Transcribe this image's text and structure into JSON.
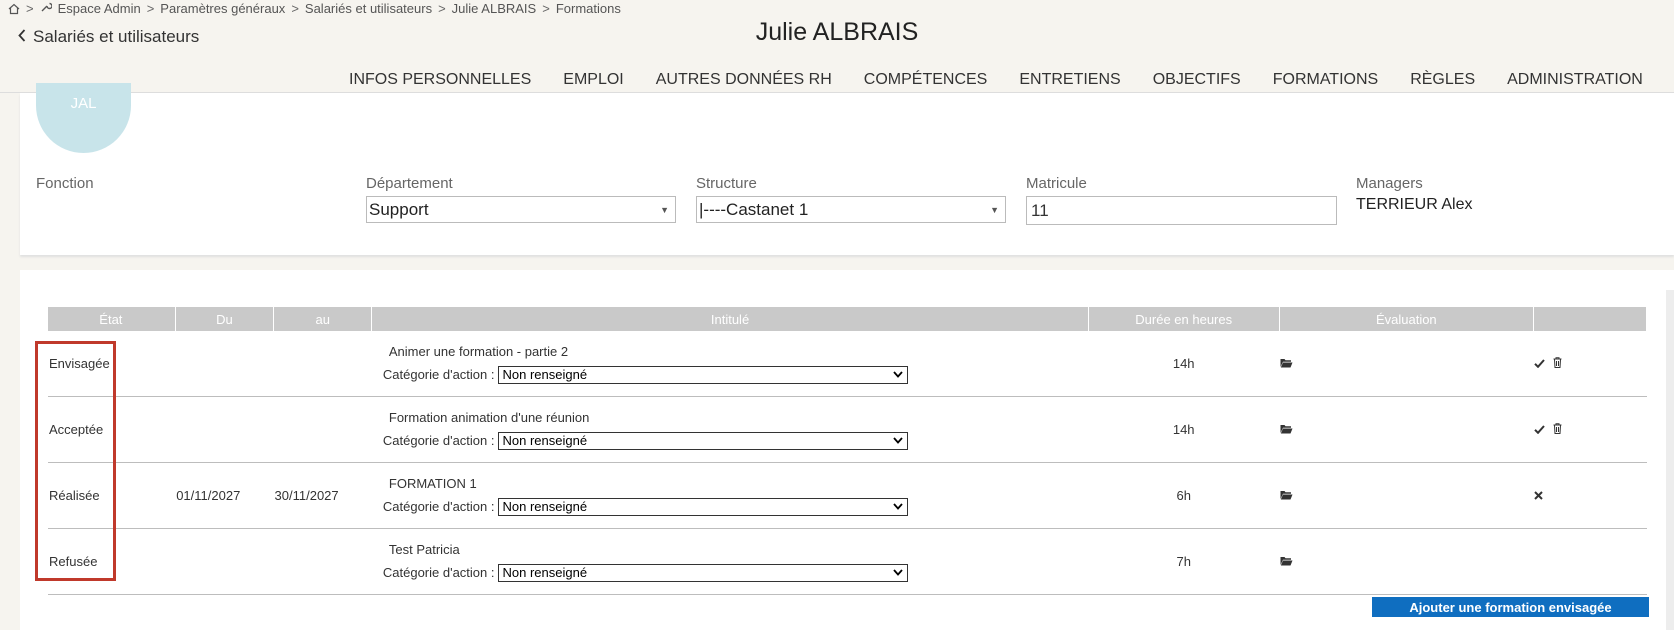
{
  "breadcrumb": {
    "items": [
      "Espace Admin",
      "Paramètres généraux",
      "Salariés et utilisateurs",
      "Julie ALBRAIS",
      "Formations"
    ],
    "separator": ">"
  },
  "header": {
    "back_label": "Salariés et utilisateurs",
    "title": "Julie ALBRAIS"
  },
  "tabs": [
    {
      "label": "INFOS PERSONNELLES"
    },
    {
      "label": "EMPLOI"
    },
    {
      "label": "AUTRES DONNÉES RH"
    },
    {
      "label": "COMPÉTENCES"
    },
    {
      "label": "ENTRETIENS"
    },
    {
      "label": "OBJECTIFS"
    },
    {
      "label": "FORMATIONS"
    },
    {
      "label": "RÈGLES"
    },
    {
      "label": "ADMINISTRATION"
    }
  ],
  "active_tab_index": 6,
  "profile": {
    "initials": "JAL",
    "fonction_label": "Fonction",
    "fonction_value": "",
    "departement_label": "Département",
    "departement_value": "Support",
    "structure_label": "Structure",
    "structure_value": "|----Castanet 1",
    "matricule_label": "Matricule",
    "matricule_value": "11",
    "managers_label": "Managers",
    "managers_value": "TERRIEUR Alex"
  },
  "table": {
    "headers": [
      "État",
      "Du",
      "au",
      "Intitulé",
      "Durée en heures",
      "Évaluation",
      ""
    ],
    "category_label": "Catégorie d'action :",
    "rows": [
      {
        "etat": "Envisagée",
        "du": "",
        "au": "",
        "intitule": "Animer une formation - partie 2",
        "categorie": "Non renseigné",
        "duree": "14h",
        "actions": [
          "check",
          "trash"
        ]
      },
      {
        "etat": "Acceptée",
        "du": "",
        "au": "",
        "intitule": "Formation animation d'une réunion",
        "categorie": "Non renseigné",
        "duree": "14h",
        "actions": [
          "check",
          "trash"
        ]
      },
      {
        "etat": "Réalisée",
        "du": "01/11/2027",
        "au": "30/11/2027",
        "intitule": "FORMATION 1",
        "categorie": "Non renseigné",
        "duree": "6h",
        "actions": [
          "close"
        ]
      },
      {
        "etat": "Refusée",
        "du": "",
        "au": "",
        "intitule": "Test Patricia",
        "categorie": "Non renseigné",
        "duree": "7h",
        "actions": []
      }
    ]
  },
  "add_button_label": "Ajouter une formation envisagée",
  "colors": {
    "accent": "#1f4e5f",
    "button": "#0f6ec0",
    "highlight": "#c0392b",
    "avatar": "#c8e4ea"
  }
}
